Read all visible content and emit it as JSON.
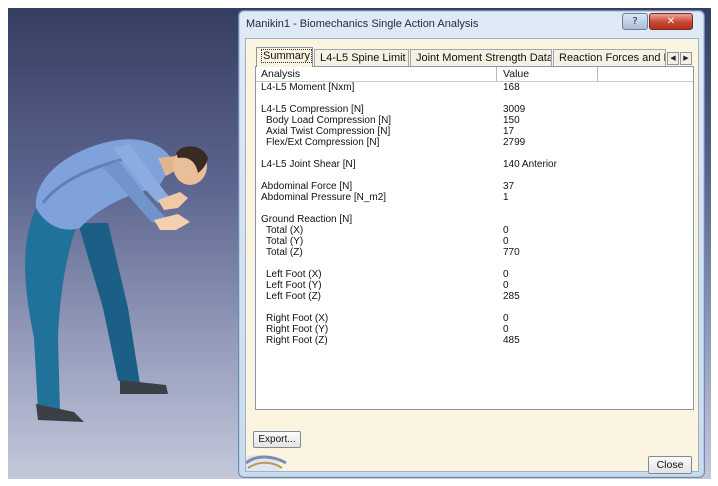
{
  "window": {
    "title": "Manikin1 - Biomechanics Single Action Analysis",
    "help_label": "?",
    "close_label": "✕"
  },
  "tabs": [
    {
      "label": "Summary",
      "active": true
    },
    {
      "label": "L4-L5 Spine Limit",
      "active": false
    },
    {
      "label": "Joint Moment Strength Data",
      "active": false
    },
    {
      "label": "Reaction Forces and Mo",
      "active": false
    }
  ],
  "tab_scroll": {
    "left": "◀",
    "right": "▶"
  },
  "table": {
    "headers": [
      "Analysis",
      "Value"
    ],
    "rows": [
      {
        "label": "L4-L5 Moment [Nxm]",
        "value": "168",
        "indent": false
      },
      {
        "label": "",
        "value": "",
        "indent": false
      },
      {
        "label": "L4-L5 Compression [N]",
        "value": "3009",
        "indent": false
      },
      {
        "label": "Body Load Compression [N]",
        "value": "150",
        "indent": true
      },
      {
        "label": "Axial Twist Compression [N]",
        "value": "17",
        "indent": true
      },
      {
        "label": "Flex/Ext Compression [N]",
        "value": "2799",
        "indent": true
      },
      {
        "label": "",
        "value": "",
        "indent": false
      },
      {
        "label": "L4-L5 Joint Shear [N]",
        "value": "140  Anterior",
        "indent": false
      },
      {
        "label": "",
        "value": "",
        "indent": false
      },
      {
        "label": "Abdominal Force [N]",
        "value": "37",
        "indent": false
      },
      {
        "label": "Abdominal Pressure [N_m2]",
        "value": "1",
        "indent": false
      },
      {
        "label": "",
        "value": "",
        "indent": false
      },
      {
        "label": "Ground Reaction [N]",
        "value": "",
        "indent": false
      },
      {
        "label": "Total (X)",
        "value": "0",
        "indent": true
      },
      {
        "label": "Total (Y)",
        "value": "0",
        "indent": true
      },
      {
        "label": "Total (Z)",
        "value": "770",
        "indent": true
      },
      {
        "label": "",
        "value": "",
        "indent": false
      },
      {
        "label": "Left Foot (X)",
        "value": "0",
        "indent": true
      },
      {
        "label": "Left Foot (Y)",
        "value": "0",
        "indent": true
      },
      {
        "label": "Left Foot (Z)",
        "value": "285",
        "indent": true
      },
      {
        "label": "",
        "value": "",
        "indent": false
      },
      {
        "label": "Right Foot (X)",
        "value": "0",
        "indent": true
      },
      {
        "label": "Right Foot (Y)",
        "value": "0",
        "indent": true
      },
      {
        "label": "Right Foot (Z)",
        "value": "485",
        "indent": true
      }
    ]
  },
  "buttons": {
    "export": "Export...",
    "close": "Close"
  },
  "colors": {
    "viewport_top": "#353d61",
    "viewport_bottom": "#c4c8da",
    "dialog_bg": "#fbf4e1",
    "shirt": "#7d9fd8",
    "pants": "#1f6f96"
  }
}
